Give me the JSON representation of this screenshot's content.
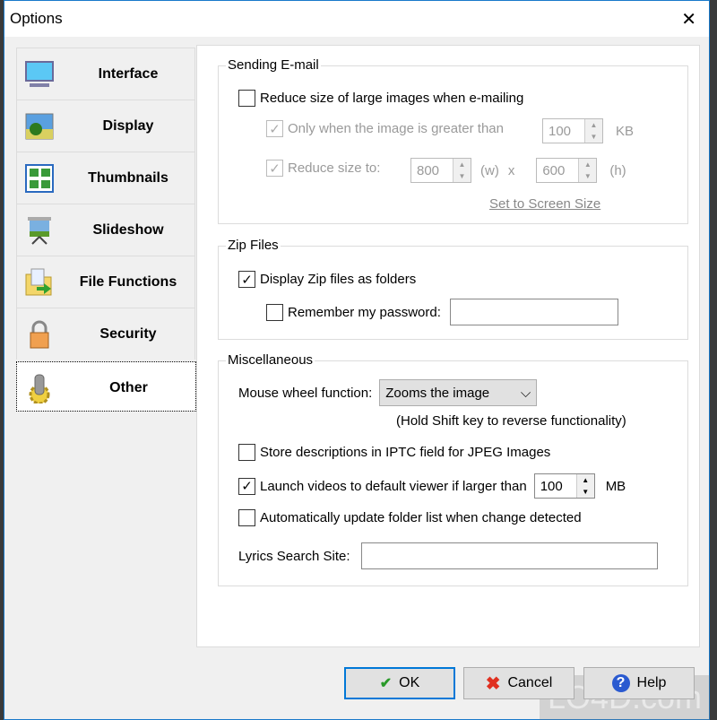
{
  "window": {
    "title": "Options"
  },
  "sidebar": {
    "items": [
      {
        "label": "Interface",
        "icon": "monitor-icon"
      },
      {
        "label": "Display",
        "icon": "picture-icon"
      },
      {
        "label": "Thumbnails",
        "icon": "thumbnails-icon"
      },
      {
        "label": "Slideshow",
        "icon": "projector-icon"
      },
      {
        "label": "File Functions",
        "icon": "folder-arrow-icon"
      },
      {
        "label": "Security",
        "icon": "padlock-icon"
      },
      {
        "label": "Other",
        "icon": "gear-icon",
        "active": true
      }
    ]
  },
  "email": {
    "title": "Sending E-mail",
    "reduce": "Reduce size of large images when e-mailing",
    "only_when": "Only when the image is greater than",
    "only_value": "100",
    "kb": "KB",
    "reduce_to": "Reduce size to:",
    "w_value": "800",
    "w_label": "(w)",
    "x": "x",
    "h_value": "600",
    "h_label": "(h)",
    "set_screen": "Set to Screen Size"
  },
  "zip": {
    "title": "Zip Files",
    "display": "Display Zip files as folders",
    "remember": "Remember my password:",
    "password": ""
  },
  "misc": {
    "title": "Miscellaneous",
    "mouse_label": "Mouse wheel function:",
    "mouse_value": "Zooms the image",
    "hint": "(Hold Shift key to reverse functionality)",
    "iptc": "Store descriptions in IPTC field for JPEG Images",
    "launch": "Launch videos to default viewer if larger than",
    "launch_value": "100",
    "mb": "MB",
    "auto": "Automatically update folder list when change detected",
    "lyrics": "Lyrics Search Site:",
    "lyrics_value": ""
  },
  "buttons": {
    "ok": "OK",
    "cancel": "Cancel",
    "help": "Help"
  },
  "watermark": "LO4D.com"
}
